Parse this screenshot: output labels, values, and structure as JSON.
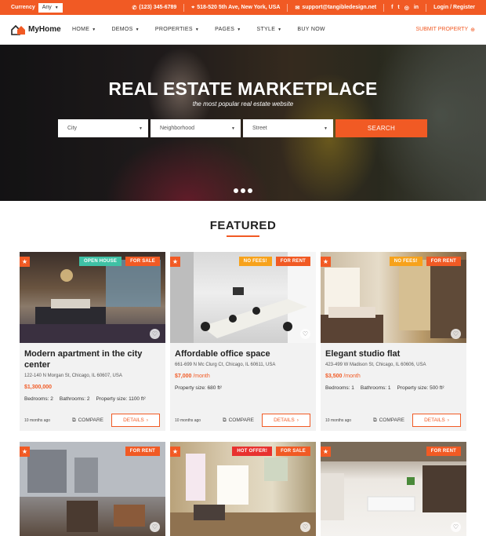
{
  "topbar": {
    "currency_label": "Currency",
    "currency_value": "Any",
    "phone": "(123) 345-6789",
    "address": "518-520 5th Ave, New York, USA",
    "email": "support@tangibledesign.net",
    "login": "Login / Register"
  },
  "nav": {
    "logo_text": "MyHome",
    "menu": [
      "HOME",
      "DEMOS",
      "PROPERTIES",
      "PAGES",
      "STYLE",
      "BUY NOW"
    ],
    "submit": "SUBMIT PROPERTY"
  },
  "hero": {
    "title": "REAL ESTATE MARKETPLACE",
    "subtitle": "the most popular real estate website",
    "city": "City",
    "neighborhood": "Neighborhood",
    "street": "Street",
    "search_btn": "SEARCH"
  },
  "featured": {
    "heading": "FEATURED"
  },
  "colors": {
    "accent": "#f15a24",
    "open_house": "#3fc1a5",
    "no_fees": "#f7a21b",
    "hot_offer": "#e8312f"
  },
  "cards": [
    {
      "tags": [
        "OPEN HOUSE",
        "FOR SALE"
      ],
      "title": "Modern apartment in the city center",
      "address": "122-140 N Morgan St, Chicago, IL 60607, USA",
      "price": "$1,300,000",
      "period": "",
      "specs": [
        "Bedrooms: 2",
        "Bathrooms: 2",
        "Property size: 1100 ft²"
      ],
      "ago": "10 months ago",
      "compare": "COMPARE",
      "details": "DETAILS"
    },
    {
      "tags": [
        "NO FEES!",
        "FOR RENT"
      ],
      "title": "Affordable office space",
      "address": "661-699 N Mc Clurg Ct, Chicago, IL 60611, USA",
      "price": "$7,000",
      "period": " /month",
      "specs": [
        "Property size: 680 ft²"
      ],
      "ago": "10 months ago",
      "compare": "COMPARE",
      "details": "DETAILS"
    },
    {
      "tags": [
        "NO FEES!",
        "FOR RENT"
      ],
      "title": "Elegant studio flat",
      "address": "423-499 W Madison St, Chicago, IL 60606, USA",
      "price": "$3,500",
      "period": " /month",
      "specs": [
        "Bedrooms: 1",
        "Bathrooms: 1",
        "Property size: 500 ft²"
      ],
      "ago": "10 months ago",
      "compare": "COMPARE",
      "details": "DETAILS"
    },
    {
      "tags": [
        "FOR RENT"
      ]
    },
    {
      "tags": [
        "HOT OFFER!",
        "FOR SALE"
      ]
    },
    {
      "tags": [
        "FOR RENT"
      ]
    }
  ]
}
